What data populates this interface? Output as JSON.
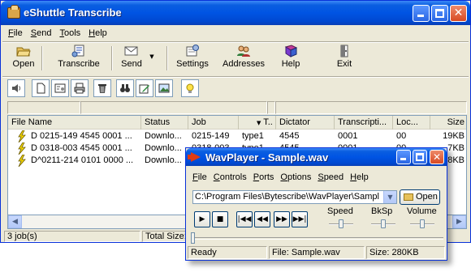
{
  "main": {
    "title": "eShuttle Transcribe",
    "menu": [
      "File",
      "Send",
      "Tools",
      "Help"
    ],
    "toolbar": {
      "open": "Open",
      "transcribe": "Transcribe",
      "send": "Send",
      "settings": "Settings",
      "addresses": "Addresses",
      "help": "Help",
      "exit": "Exit"
    },
    "list": {
      "columns": [
        "File Name",
        "Status",
        "Job",
        "T..",
        "Dictator",
        "Transcripti...",
        "Loc...",
        "Size"
      ],
      "rows": [
        [
          "D 0215-149 4545 0001 ...",
          "Downlo...",
          "0215-149",
          "type1",
          "4545",
          "0001",
          "00",
          "19KB"
        ],
        [
          "D 0318-003 4545 0001 ...",
          "Downlo...",
          "0318-003",
          "type1",
          "4545",
          "0001",
          "00",
          "7KB"
        ],
        [
          "D^0211-214 0101 0000 ...",
          "Downlo...",
          "0211-214",
          "type1",
          "0101",
          "0000",
          "00",
          "8KB"
        ]
      ]
    },
    "status": {
      "jobs": "3 job(s)",
      "total_size_label": "Total Size:"
    }
  },
  "wavplayer": {
    "title": "WavPlayer - Sample.wav",
    "menu": [
      "File",
      "Controls",
      "Ports",
      "Options",
      "Speed",
      "Help"
    ],
    "path": "C:\\Program Files\\Bytescribe\\WavPlayer\\Sampl",
    "open_label": "Open",
    "transport": [
      "▶",
      "■",
      "|◀◀",
      "◀◀",
      "▶▶",
      "▶▶|"
    ],
    "labels": {
      "speed": "Speed",
      "bksp": "BkSp",
      "volume": "Volume"
    },
    "status": {
      "state": "Ready",
      "file": "File: Sample.wav",
      "size": "Size: 280KB"
    }
  },
  "colors": {
    "titlebar": "#0054e3",
    "window_bg": "#ece9d8",
    "close_button": "#d84a23",
    "bolt": "#f5d800"
  },
  "icons": [
    "app-briefcase-icon",
    "open-folder-icon",
    "transcribe-icon",
    "send-icon",
    "settings-icon",
    "addresses-icon",
    "help-book-icon",
    "exit-icon",
    "audio-file-icon",
    "lightning-bolt-icon",
    "wavplayer-icon"
  ]
}
